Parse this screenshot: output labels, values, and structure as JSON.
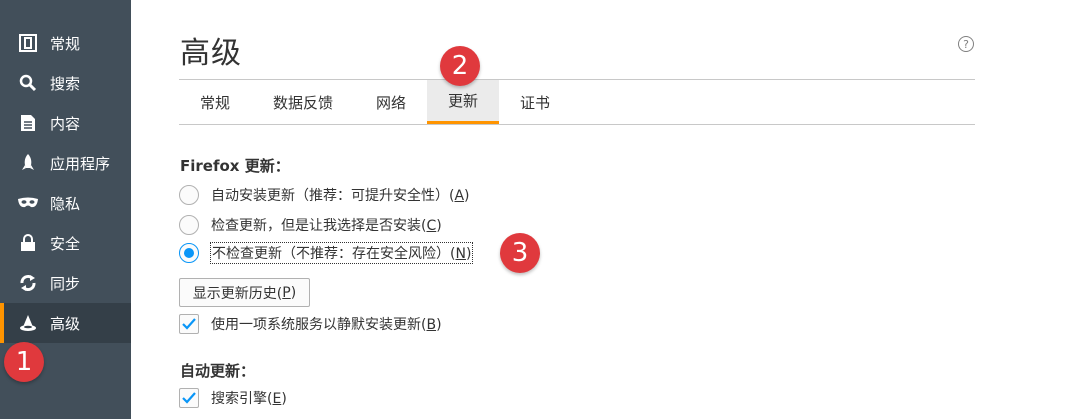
{
  "sidebar": {
    "items": [
      {
        "label": "常规",
        "icon": "general-icon"
      },
      {
        "label": "搜索",
        "icon": "search-icon"
      },
      {
        "label": "内容",
        "icon": "document-icon"
      },
      {
        "label": "应用程序",
        "icon": "rocket-icon"
      },
      {
        "label": "隐私",
        "icon": "mask-icon"
      },
      {
        "label": "安全",
        "icon": "lock-icon"
      },
      {
        "label": "同步",
        "icon": "sync-icon"
      },
      {
        "label": "高级",
        "icon": "wizard-hat-icon",
        "active": true
      }
    ]
  },
  "page": {
    "title": "高级",
    "help_icon_glyph": "?"
  },
  "tabs": [
    {
      "label": "常规"
    },
    {
      "label": "数据反馈"
    },
    {
      "label": "网络"
    },
    {
      "label": "更新",
      "active": true
    },
    {
      "label": "证书"
    }
  ],
  "firefox_update": {
    "title": "Firefox 更新：",
    "options": [
      {
        "text": "自动安装更新（推荐：可提升安全性）(",
        "key": "A",
        "tail": ")",
        "checked": false
      },
      {
        "text": "检查更新，但是让我选择是否安装(",
        "key": "C",
        "tail": ")",
        "checked": false
      },
      {
        "text": "不检查更新（不推荐：存在安全风险）(",
        "key": "N",
        "tail": ")",
        "checked": true
      }
    ],
    "history_button": {
      "text": "显示更新历史(",
      "key": "P",
      "tail": ")"
    },
    "background_service": {
      "text": "使用一项系统服务以静默安装更新(",
      "key": "B",
      "tail": ")",
      "checked": true
    }
  },
  "auto_update": {
    "title": "自动更新：",
    "search_engines": {
      "text": "搜索引擎(",
      "key": "E",
      "tail": ")",
      "checked": true
    }
  },
  "callouts": {
    "one": "1",
    "two": "2",
    "three": "3"
  },
  "colors": {
    "sidebar_bg": "#424f5a",
    "sidebar_active_bg": "#343f48",
    "accent_orange": "#ff9400",
    "radio_blue": "#0996f8",
    "callout_red": "#e0393d"
  }
}
